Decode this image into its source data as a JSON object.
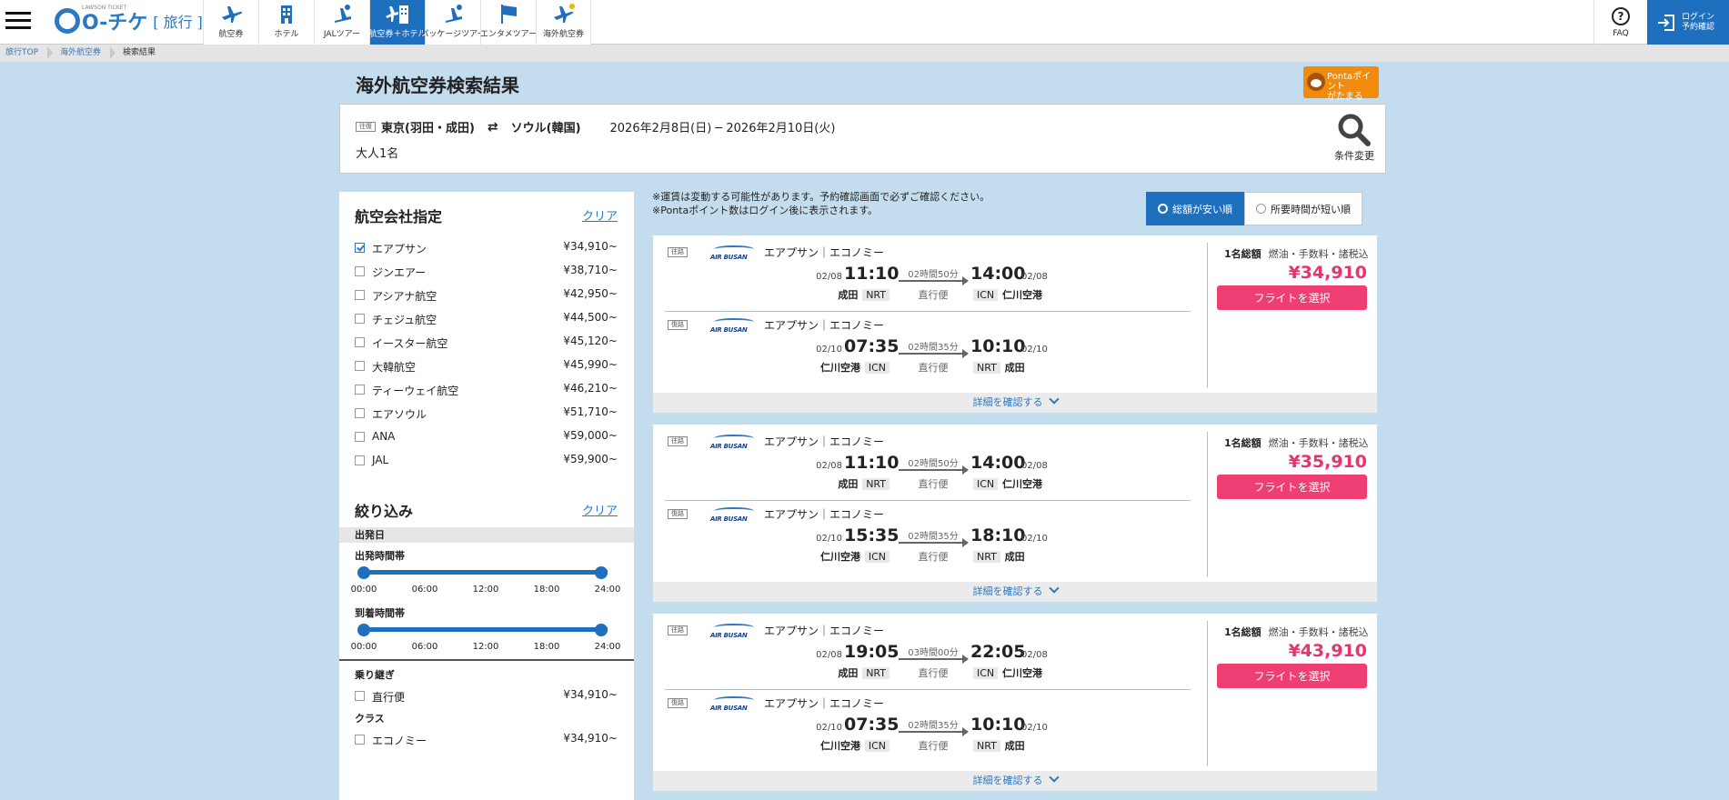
{
  "header": {
    "logo_main": "O-チケ",
    "logo_sub": "旅行",
    "logo_tagline": "LAWSON TICKET",
    "nav": [
      {
        "label": "航空券",
        "icon": "airplane-icon",
        "active": false
      },
      {
        "label": "ホテル",
        "icon": "hotel-icon",
        "active": false
      },
      {
        "label": "JALツアー",
        "icon": "jal-tour-icon",
        "active": false
      },
      {
        "label": "航空券＋ホテル",
        "icon": "airplane-hotel-icon",
        "active": true
      },
      {
        "label": "パッケージツアー",
        "icon": "package-tour-icon",
        "active": false
      },
      {
        "label": "エンタメツアー",
        "icon": "flag-icon",
        "active": false
      },
      {
        "label": "海外航空券",
        "icon": "overseas-airplane-icon",
        "active": false
      }
    ],
    "faq": "FAQ",
    "login_line1": "ログイン",
    "login_line2": "予約確認"
  },
  "breadcrumb": [
    "旅行TOP",
    "海外航空券",
    "検索結果"
  ],
  "page_title": "海外航空券検索結果",
  "ponta": {
    "line1": "Pontaポイント",
    "line2": "がたまる"
  },
  "search": {
    "tag": "往復",
    "from": "東京(羽田・成田)",
    "to": "ソウル(韓国)",
    "dates": "2026年2月8日(日) ─ 2026年2月10日(火)",
    "pax": "大人1名",
    "change": "条件変更"
  },
  "sidebar": {
    "airline_title": "航空会社指定",
    "clear": "クリア",
    "airlines": [
      {
        "name": "エアプサン",
        "price": "¥34,910~",
        "checked": true
      },
      {
        "name": "ジンエアー",
        "price": "¥38,710~",
        "checked": false
      },
      {
        "name": "アシアナ航空",
        "price": "¥42,950~",
        "checked": false
      },
      {
        "name": "チェジュ航空",
        "price": "¥44,500~",
        "checked": false
      },
      {
        "name": "イースター航空",
        "price": "¥45,120~",
        "checked": false
      },
      {
        "name": "大韓航空",
        "price": "¥45,990~",
        "checked": false
      },
      {
        "name": "ティーウェイ航空",
        "price": "¥46,210~",
        "checked": false
      },
      {
        "name": "エアソウル",
        "price": "¥51,710~",
        "checked": false
      },
      {
        "name": "ANA",
        "price": "¥59,000~",
        "checked": false
      },
      {
        "name": "JAL",
        "price": "¥59,900~",
        "checked": false
      }
    ],
    "refine_title": "絞り込み",
    "departure_day": "出発日",
    "depart_time_label": "出発時間帯",
    "arrive_time_label": "到着時間帯",
    "ticks": [
      "00:00",
      "06:00",
      "12:00",
      "18:00",
      "24:00"
    ],
    "transfer_label": "乗り継ぎ",
    "transfer_option": "直行便",
    "transfer_price": "¥34,910~",
    "class_label": "クラス",
    "class_option": "エコノミー",
    "class_price": "¥34,910~"
  },
  "notes": [
    "※運賃は変動する可能性があります。予約確認画面で必ずご確認ください。",
    "※Pontaポイント数はログイン後に表示されます。"
  ],
  "sort": {
    "cheapest": "総額が安い順",
    "shortest": "所要時間が短い順"
  },
  "results": [
    {
      "price": "¥34,910",
      "price_note": "燃油・手数料・諸税込",
      "per_person": "1名総額",
      "select": "フライトを選択",
      "detail": "詳細を確認する",
      "outbound": {
        "tag": "往路",
        "logo": "AIR BUSAN",
        "airline": "エアプサン｜エコノミー",
        "dep_date": "02/08",
        "dep_time": "11:10",
        "dep_airport": "成田",
        "dep_code": "NRT",
        "duration": "02時間50分",
        "nonstop": "直行便",
        "arr_time": "14:00",
        "arr_date": "02/08",
        "arr_code": "ICN",
        "arr_airport": "仁川空港"
      },
      "inbound": {
        "tag": "復路",
        "logo": "AIR BUSAN",
        "airline": "エアプサン｜エコノミー",
        "dep_date": "02/10",
        "dep_time": "07:35",
        "dep_airport": "仁川空港",
        "dep_code": "ICN",
        "duration": "02時間35分",
        "nonstop": "直行便",
        "arr_time": "10:10",
        "arr_date": "02/10",
        "arr_code": "NRT",
        "arr_airport": "成田"
      }
    },
    {
      "price": "¥35,910",
      "price_note": "燃油・手数料・諸税込",
      "per_person": "1名総額",
      "select": "フライトを選択",
      "detail": "詳細を確認する",
      "outbound": {
        "tag": "往路",
        "logo": "AIR BUSAN",
        "airline": "エアプサン｜エコノミー",
        "dep_date": "02/08",
        "dep_time": "11:10",
        "dep_airport": "成田",
        "dep_code": "NRT",
        "duration": "02時間50分",
        "nonstop": "直行便",
        "arr_time": "14:00",
        "arr_date": "02/08",
        "arr_code": "ICN",
        "arr_airport": "仁川空港"
      },
      "inbound": {
        "tag": "復路",
        "logo": "AIR BUSAN",
        "airline": "エアプサン｜エコノミー",
        "dep_date": "02/10",
        "dep_time": "15:35",
        "dep_airport": "仁川空港",
        "dep_code": "ICN",
        "duration": "02時間35分",
        "nonstop": "直行便",
        "arr_time": "18:10",
        "arr_date": "02/10",
        "arr_code": "NRT",
        "arr_airport": "成田"
      }
    },
    {
      "price": "¥43,910",
      "price_note": "燃油・手数料・諸税込",
      "per_person": "1名総額",
      "select": "フライトを選択",
      "detail": "詳細を確認する",
      "outbound": {
        "tag": "往路",
        "logo": "AIR BUSAN",
        "airline": "エアプサン｜エコノミー",
        "dep_date": "02/08",
        "dep_time": "19:05",
        "dep_airport": "成田",
        "dep_code": "NRT",
        "duration": "03時間00分",
        "nonstop": "直行便",
        "arr_time": "22:05",
        "arr_date": "02/08",
        "arr_code": "ICN",
        "arr_airport": "仁川空港"
      },
      "inbound": {
        "tag": "復路",
        "logo": "AIR BUSAN",
        "airline": "エアプサン｜エコノミー",
        "dep_date": "02/10",
        "dep_time": "07:35",
        "dep_airport": "仁川空港",
        "dep_code": "ICN",
        "duration": "02時間35分",
        "nonstop": "直行便",
        "arr_time": "10:10",
        "arr_date": "02/10",
        "arr_code": "NRT",
        "arr_airport": "成田"
      }
    }
  ],
  "colors": {
    "brand": "#1f6fbf",
    "accent": "#ee3e74",
    "price": "#e8346c",
    "background": "#c3ddef"
  }
}
